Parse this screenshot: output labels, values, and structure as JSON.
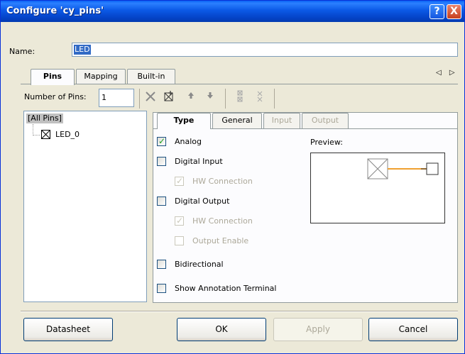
{
  "window": {
    "title": "Configure 'cy_pins'",
    "help_glyph": "?",
    "close_glyph": "X"
  },
  "name": {
    "label": "Name:",
    "value": "LED"
  },
  "main_tabs": [
    {
      "label": "Pins",
      "active": true
    },
    {
      "label": "Mapping",
      "active": false
    },
    {
      "label": "Built-in",
      "active": false
    }
  ],
  "tab_scroll": "◁ ▷",
  "pins": {
    "label": "Number of Pins:",
    "value": "1"
  },
  "toolbar": {
    "delete_icon": "delete-icon",
    "add_icon": "add-pin-icon",
    "up_icon": "move-up-icon",
    "down_icon": "move-down-icon",
    "distribute_icon": "distribute-icon",
    "collapse_icon": "collapse-icon"
  },
  "tree": {
    "root": "[All Pins]",
    "items": [
      "LED_0"
    ]
  },
  "sub_tabs": [
    {
      "label": "Type",
      "active": true,
      "disabled": false
    },
    {
      "label": "General",
      "active": false,
      "disabled": false
    },
    {
      "label": "Input",
      "active": false,
      "disabled": true
    },
    {
      "label": "Output",
      "active": false,
      "disabled": true
    }
  ],
  "type_options": {
    "analog": {
      "label": "Analog",
      "checked": true
    },
    "digital_input": {
      "label": "Digital Input",
      "checked": false
    },
    "digital_input_hw": {
      "label": "HW Connection",
      "checked": true,
      "disabled": true
    },
    "digital_output": {
      "label": "Digital Output",
      "checked": false
    },
    "digital_output_hw": {
      "label": "HW Connection",
      "checked": true,
      "disabled": true
    },
    "output_enable": {
      "label": "Output Enable",
      "checked": false,
      "disabled": true
    },
    "bidirectional": {
      "label": "Bidirectional",
      "checked": false
    },
    "annotation": {
      "label": "Show Annotation Terminal",
      "checked": false
    }
  },
  "preview": {
    "label": "Preview:",
    "wire_color": "#f0a030"
  },
  "buttons": {
    "datasheet": "Datasheet",
    "ok": "OK",
    "apply": "Apply",
    "cancel": "Cancel"
  }
}
